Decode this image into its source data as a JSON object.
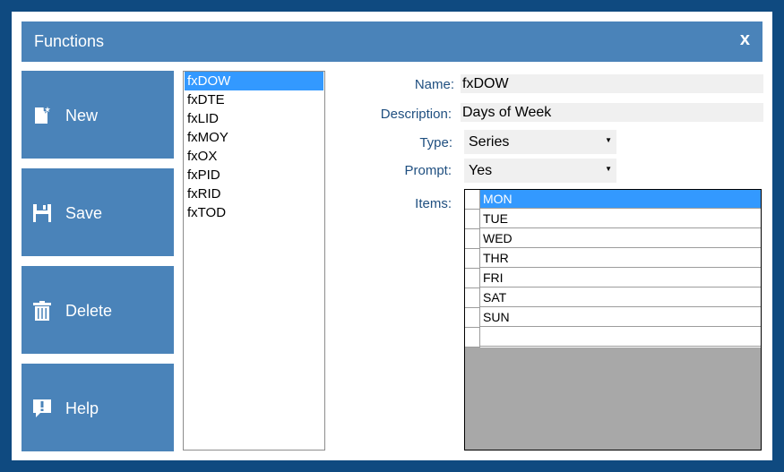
{
  "window": {
    "title": "Functions",
    "close_label": "x"
  },
  "sidebar": {
    "buttons": [
      {
        "label": "New",
        "icon": "new-document-icon"
      },
      {
        "label": "Save",
        "icon": "floppy-disk-icon"
      },
      {
        "label": "Delete",
        "icon": "trash-icon"
      },
      {
        "label": "Help",
        "icon": "help-icon"
      }
    ]
  },
  "functions_list": {
    "items": [
      "fxDOW",
      "fxDTE",
      "fxLID",
      "fxMOY",
      "fxOX",
      "fxPID",
      "fxRID",
      "fxTOD"
    ],
    "selected": "fxDOW"
  },
  "form": {
    "name_label": "Name:",
    "name_value": "fxDOW",
    "description_label": "Description:",
    "description_value": "Days of Week",
    "type_label": "Type:",
    "type_value": "Series",
    "prompt_label": "Prompt:",
    "prompt_value": "Yes",
    "items_label": "Items:"
  },
  "items_grid": {
    "rows": [
      "MON",
      "TUE",
      "WED",
      "THR",
      "FRI",
      "SAT",
      "SUN",
      ""
    ],
    "selected": "MON"
  },
  "colors": {
    "frame": "#0f4a80",
    "accent": "#4a83b9",
    "selection": "#3399ff",
    "label_text": "#1f4f80"
  }
}
